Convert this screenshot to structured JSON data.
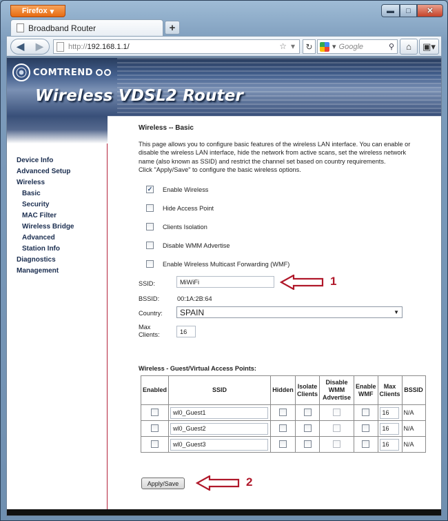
{
  "browser": {
    "app_menu": "Firefox",
    "tab_title": "Broadband Router",
    "new_tab": "+",
    "url_scheme": "http://",
    "url_host": "192.168.1.1/",
    "search_placeholder": "Google",
    "window_controls": {
      "minimize": "▬",
      "maximize": "□",
      "close": "✕"
    }
  },
  "banner": {
    "logo_text": "COMTREND",
    "title": "Wireless VDSL2 Router"
  },
  "sidebar": {
    "items": [
      {
        "label": "Device Info",
        "level": 0
      },
      {
        "label": "Advanced Setup",
        "level": 0
      },
      {
        "label": "Wireless",
        "level": 0
      },
      {
        "label": "Basic",
        "level": 1
      },
      {
        "label": "Security",
        "level": 1
      },
      {
        "label": "MAC Filter",
        "level": 1
      },
      {
        "label": "Wireless Bridge",
        "level": 1
      },
      {
        "label": "Advanced",
        "level": 1
      },
      {
        "label": "Station Info",
        "level": 1
      },
      {
        "label": "Diagnostics",
        "level": 0
      },
      {
        "label": "Management",
        "level": 0
      }
    ]
  },
  "main": {
    "heading": "Wireless -- Basic",
    "description": "This page allows you to configure basic features of the wireless LAN interface. You can enable or disable the wireless LAN interface, hide the network from active scans, set the wireless network name (also known as SSID) and restrict the channel set based on country requirements.",
    "description2": "Click \"Apply/Save\" to configure the basic wireless options.",
    "options": [
      {
        "label": "Enable Wireless",
        "checked": true
      },
      {
        "label": "Hide Access Point",
        "checked": false
      },
      {
        "label": "Clients Isolation",
        "checked": false
      },
      {
        "label": "Disable WMM Advertise",
        "checked": false
      },
      {
        "label": "Enable Wireless Multicast Forwarding (WMF)",
        "checked": false
      }
    ],
    "ssid_label": "SSID:",
    "ssid_value": "MiWiFi",
    "bssid_label": "BSSID:",
    "bssid_value": "00:1A:2B:64",
    "country_label": "Country:",
    "country_value": "SPAIN",
    "max_clients_label": "Max Clients:",
    "max_clients_value": "16",
    "annotation_1": "1",
    "annotation_2": "2",
    "guest_heading": "Wireless - Guest/Virtual Access Points:",
    "guest_table": {
      "headers": [
        "Enabled",
        "SSID",
        "Hidden",
        "Isolate Clients",
        "Disable WMM Advertise",
        "Enable WMF",
        "Max Clients",
        "BSSID"
      ],
      "rows": [
        {
          "ssid": "wl0_Guest1",
          "max": "16",
          "bssid": "N/A"
        },
        {
          "ssid": "wl0_Guest2",
          "max": "16",
          "bssid": "N/A"
        },
        {
          "ssid": "wl0_Guest3",
          "max": "16",
          "bssid": "N/A"
        }
      ]
    },
    "apply_button": "Apply/Save"
  },
  "colors": {
    "accent_red": "#b0182a",
    "menu_text": "#1a2d4f"
  }
}
